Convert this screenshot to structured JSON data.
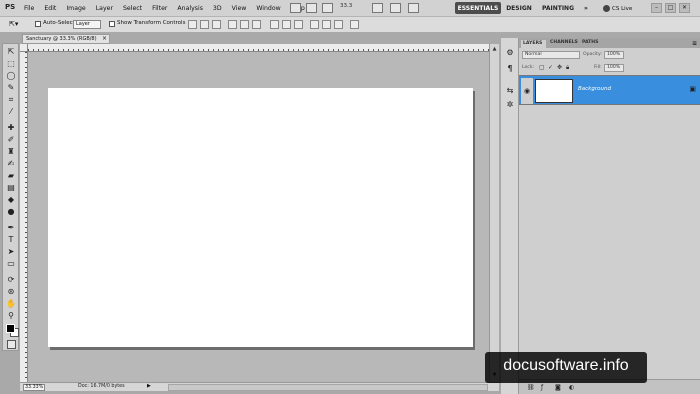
{
  "app": {
    "logo": "PS",
    "menus": [
      "File",
      "Edit",
      "Image",
      "Layer",
      "Select",
      "Filter",
      "Analysis",
      "3D",
      "View",
      "Window",
      "Help"
    ],
    "zoom_menu": "33.3"
  },
  "workspaces": {
    "active": "ESSENTIALS",
    "design": "DESIGN",
    "painting": "PAINTING",
    "more": "»"
  },
  "cs_live": "CS Live",
  "window_controls": [
    "–",
    "□",
    "✕"
  ],
  "options_bar": {
    "auto_select_label": "Auto-Select:",
    "auto_select_value": "Layer",
    "transform_label": "Show Transform Controls"
  },
  "document": {
    "tab_title": "Sanctuary @ 33.3% (RGB/8)",
    "close": "×"
  },
  "status": {
    "zoom": "33.33%",
    "info": "Doc: 16.7M/0 bytes",
    "arrow": "▶"
  },
  "panel": {
    "tabs": [
      "LAYERS",
      "CHANNELS",
      "PATHS"
    ],
    "menu_icon": "≡",
    "blend_mode": "Normal",
    "opacity_label": "Opacity:",
    "opacity_value": "100%",
    "lock_label": "Lock:",
    "fill_label": "Fill:",
    "fill_value": "100%",
    "layer_name": "Background"
  },
  "watermark": "docusoftware.info"
}
